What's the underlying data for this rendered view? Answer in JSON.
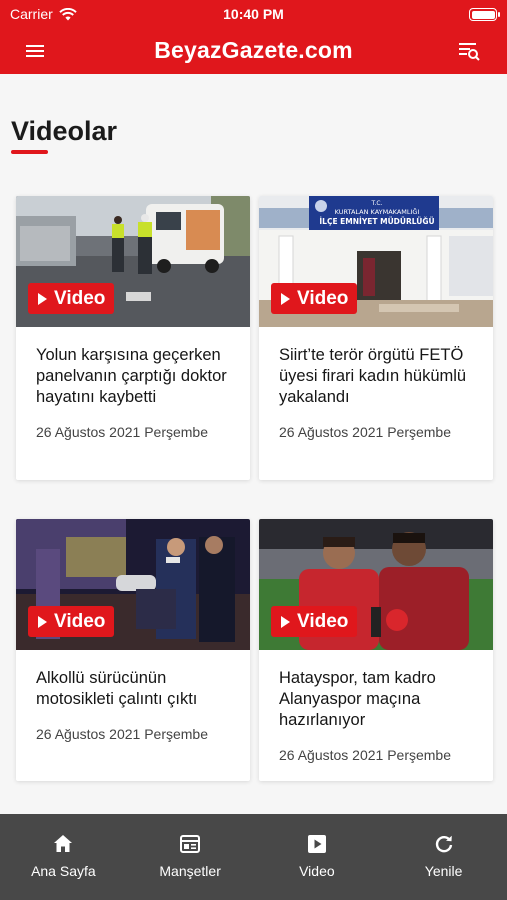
{
  "status_bar": {
    "carrier": "Carrier",
    "time": "10:40 PM"
  },
  "app_bar": {
    "title": "BeyazGazete.com",
    "menu_icon": "hamburger-menu-icon",
    "search_icon": "search-list-icon"
  },
  "section": {
    "title": "Videolar"
  },
  "videos": [
    {
      "badge": "Video",
      "headline": "Yolun karşısına geçerken panelvanın çarptığı doktor hayatını kaybetti",
      "date": "26 Ağustos 2021 Perşembe"
    },
    {
      "badge": "Video",
      "headline": "Siirt’te terör örgütü FETÖ üyesi firari kadın hükümlü yakalandı",
      "date": "26 Ağustos 2021 Perşembe",
      "sign_line1": "T.C.",
      "sign_line2": "KURTALAN KAYMAKAMLIĞI",
      "sign_line3": "İLÇE EMNİYET MÜDÜRLÜĞÜ"
    },
    {
      "badge": "Video",
      "headline": "Alkollü sürücünün motosikleti çalıntı çıktı",
      "date": "26 Ağustos 2021 Perşembe"
    },
    {
      "badge": "Video",
      "headline": "Hatayspor, tam kadro Alanyaspor maçına hazırlanıyor",
      "date": "26 Ağustos 2021 Perşembe"
    }
  ],
  "tab_bar": {
    "items": [
      {
        "label": "Ana Sayfa",
        "icon": "home-icon"
      },
      {
        "label": "Manşetler",
        "icon": "headlines-icon"
      },
      {
        "label": "Video",
        "icon": "video-play-icon"
      },
      {
        "label": "Yenile",
        "icon": "refresh-icon"
      }
    ]
  },
  "colors": {
    "brand_red": "#e0171c",
    "tabbar_bg": "#484848",
    "page_bg": "#f6f6f6"
  }
}
